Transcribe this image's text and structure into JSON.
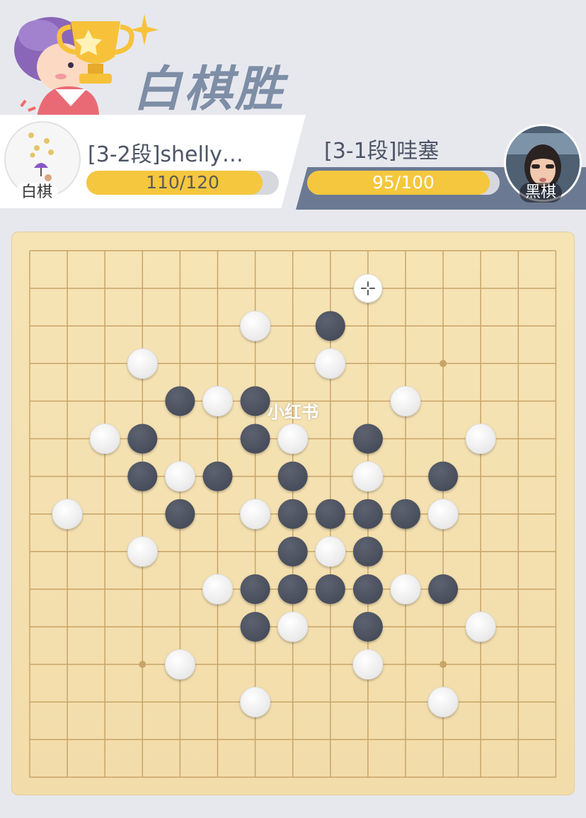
{
  "header": {
    "result_title": "白棋胜"
  },
  "players": {
    "white": {
      "name": "[3-2段]shelly…",
      "side_label": "白棋",
      "score_text": "110/120",
      "progress": 0.917
    },
    "black": {
      "name": "[3-1段]哇塞",
      "side_label": "黑棋",
      "score_text": "95/100",
      "progress": 0.95
    }
  },
  "watermark": "小红书",
  "colors": {
    "accent_yellow": "#f5c73e",
    "board": "#f4e0b0",
    "grid_line": "#c9a467",
    "black_stone": "#474c59",
    "white_stone": "#ffffff",
    "title": "#7d8ea6",
    "black_panel": "#6b7a92"
  },
  "board": {
    "size": 15,
    "star_points": [
      [
        3,
        11
      ],
      [
        11,
        11
      ],
      [
        3,
        3
      ],
      [
        11,
        3
      ],
      [
        7,
        7
      ]
    ],
    "hidden_star_points_note_excluded": false,
    "marker": {
      "col": 9,
      "row": 1,
      "icon": "move-cursor-icon"
    },
    "white_stones": [
      [
        6,
        2
      ],
      [
        3,
        3
      ],
      [
        8,
        3
      ],
      [
        5,
        4
      ],
      [
        10,
        4
      ],
      [
        2,
        5
      ],
      [
        7,
        5
      ],
      [
        12,
        5
      ],
      [
        4,
        6
      ],
      [
        9,
        6
      ],
      [
        1,
        7
      ],
      [
        6,
        7
      ],
      [
        11,
        7
      ],
      [
        3,
        8
      ],
      [
        8,
        8
      ],
      [
        5,
        9
      ],
      [
        10,
        9
      ],
      [
        7,
        10
      ],
      [
        12,
        10
      ],
      [
        4,
        11
      ],
      [
        9,
        11
      ],
      [
        6,
        12
      ],
      [
        11,
        12
      ]
    ],
    "black_stones": [
      [
        8,
        2
      ],
      [
        4,
        4
      ],
      [
        6,
        4
      ],
      [
        3,
        5
      ],
      [
        6,
        5
      ],
      [
        9,
        5
      ],
      [
        3,
        6
      ],
      [
        5,
        6
      ],
      [
        7,
        6
      ],
      [
        11,
        6
      ],
      [
        4,
        7
      ],
      [
        7,
        7
      ],
      [
        8,
        7
      ],
      [
        9,
        7
      ],
      [
        10,
        7
      ],
      [
        7,
        8
      ],
      [
        9,
        8
      ],
      [
        6,
        9
      ],
      [
        7,
        9
      ],
      [
        8,
        9
      ],
      [
        9,
        9
      ],
      [
        11,
        9
      ],
      [
        6,
        10
      ],
      [
        9,
        10
      ]
    ]
  }
}
